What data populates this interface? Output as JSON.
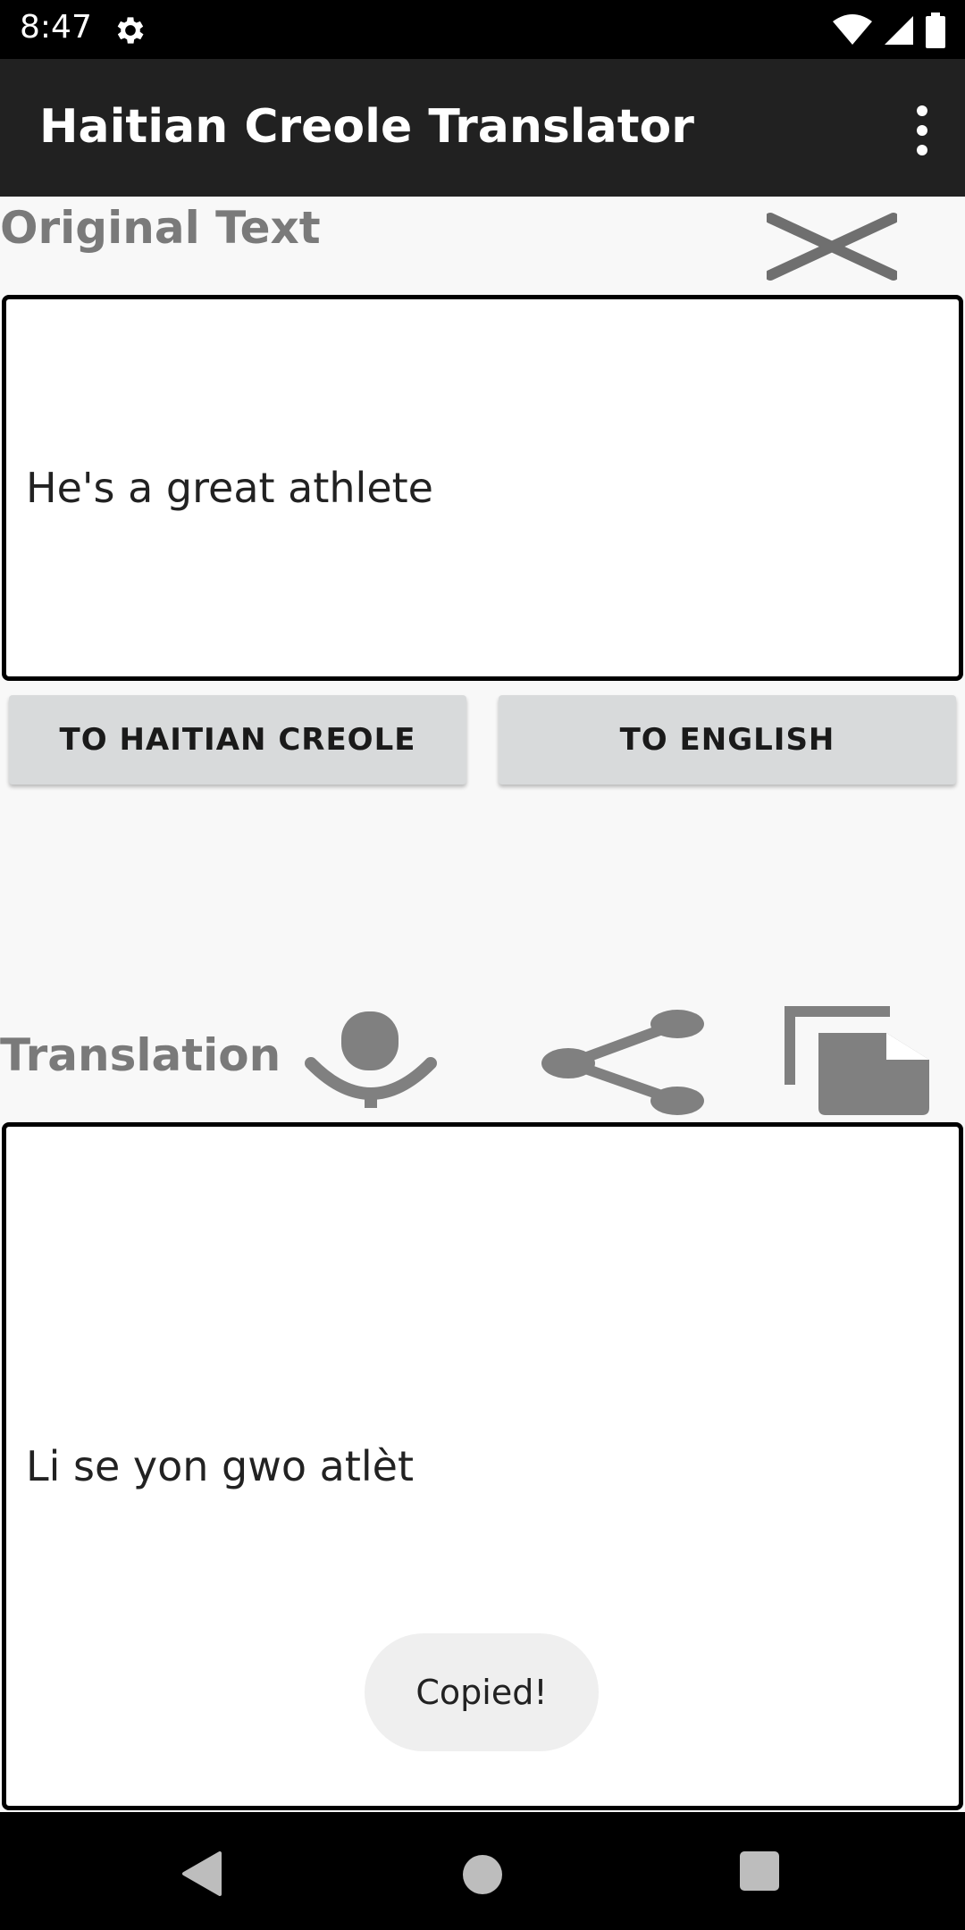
{
  "status": {
    "time": "8:47"
  },
  "app": {
    "title": "Haitian Creole Translator"
  },
  "original": {
    "label": "Original Text",
    "text": "He's a great athlete"
  },
  "buttons": {
    "to_haitian": "TO HAITIAN CREOLE",
    "to_english": "TO ENGLISH"
  },
  "translation": {
    "label": "Translation",
    "text": "Li se yon gwo atlèt"
  },
  "toast": {
    "message": "Copied!"
  },
  "icons": {
    "gear": "gear-icon",
    "wifi": "wifi-icon",
    "signal": "signal-icon",
    "battery": "battery-icon",
    "overflow": "more-vert-icon",
    "clear": "close-icon",
    "mic": "microphone-icon",
    "share": "share-icon",
    "copy": "copy-icon",
    "back": "back-icon",
    "home": "home-icon",
    "recents": "recents-icon"
  },
  "colors": {
    "appbar": "#212121",
    "label": "#7a7a7a",
    "button": "#d8dadb",
    "icon": "#808080"
  }
}
